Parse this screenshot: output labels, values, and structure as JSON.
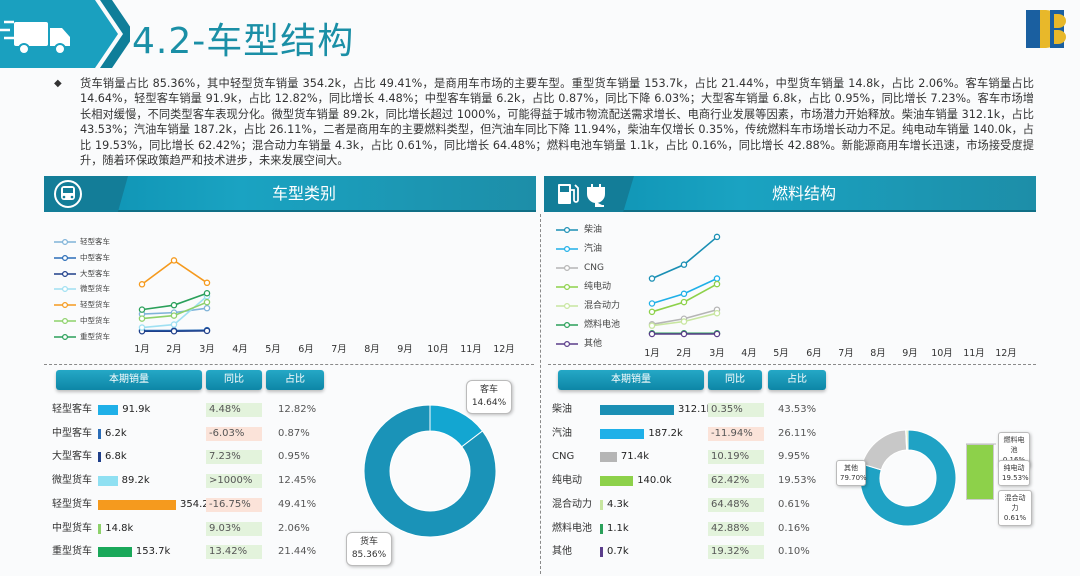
{
  "title": "4.2-车型结构",
  "summary": "货车销量占比 85.36%，其中轻型货车销量 354.2k，占比 49.41%，是商用车市场的主要车型。重型货车销量 153.7k，占比 21.44%，中型货车销量 14.8k，占比 2.06%。客车销量占比 14.64%，轻型客车销量 91.9k，占比 12.82%，同比增长 4.48%；中型客车销量 6.2k，占比 0.87%，同比下降 6.03%；大型客车销量 6.8k，占比 0.95%，同比增长 7.23%。客车市场增长相对缓慢，不同类型客车表现分化。微型货车销量 89.2k，同比增长超过 1000%，可能得益于城市物流配送需求增长、电商行业发展等因素，市场潜力开始释放。柴油车销量 312.1k，占比 43.53%；汽油车销量 187.2k，占比 26.11%，二者是商用车的主要燃料类型，但汽油车同比下降 11.94%，柴油车仅增长 0.35%，传统燃料车市场增长动力不足。纯电动车销量 140.0k，占比 19.53%，同比增长 62.42%；混合动力车销量 4.3k，占比 0.61%，同比增长 64.48%；燃料电池车销量 1.1k，占比 0.16%，同比增长 42.88%。新能源商用车增长迅速，市场接受度提升，随着环保政策趋严和技术进步，未来发展空间大。",
  "left_panel": {
    "title": "车型类别",
    "icon": "bus-icon",
    "headers": [
      "本期销量",
      "同比",
      "占比"
    ],
    "rows": [
      {
        "label": "轻型客车",
        "value": "91.9k",
        "num": 91.9,
        "color": "#1fb0e8",
        "yoy": "4.48%",
        "yoy_up": true,
        "share": "12.82%"
      },
      {
        "label": "中型客车",
        "value": "6.2k",
        "num": 6.2,
        "color": "#2a6db8",
        "yoy": "-6.03%",
        "yoy_up": false,
        "share": "0.87%"
      },
      {
        "label": "大型客车",
        "value": "6.8k",
        "num": 6.8,
        "color": "#1f3f8a",
        "yoy": "7.23%",
        "yoy_up": true,
        "share": "0.95%"
      },
      {
        "label": "微型货车",
        "value": "89.2k",
        "num": 89.2,
        "color": "#8fe0f2",
        "yoy": ">1000%",
        "yoy_up": true,
        "share": "12.45%"
      },
      {
        "label": "轻型货车",
        "value": "354.2k",
        "num": 354.2,
        "color": "#f59a1e",
        "yoy": "-16.75%",
        "yoy_up": false,
        "share": "49.41%"
      },
      {
        "label": "中型货车",
        "value": "14.8k",
        "num": 14.8,
        "color": "#8dd16a",
        "yoy": "9.03%",
        "yoy_up": true,
        "share": "2.06%"
      },
      {
        "label": "重型货车",
        "value": "153.7k",
        "num": 153.7,
        "color": "#1aa85a",
        "yoy": "13.42%",
        "yoy_up": true,
        "share": "21.44%"
      }
    ],
    "donut": [
      {
        "name": "客车",
        "value": 14.64,
        "label": "14.64%",
        "color": "#13a6d1"
      },
      {
        "name": "货车",
        "value": 85.36,
        "label": "85.36%",
        "color": "#1a93b8"
      }
    ]
  },
  "right_panel": {
    "title": "燃料结构",
    "icon": "fuel-charge-icon",
    "headers": [
      "本期销量",
      "同比",
      "占比"
    ],
    "rows": [
      {
        "label": "柴油",
        "value": "312.1k",
        "num": 312.1,
        "color": "#1a8fb4",
        "yoy": "0.35%",
        "yoy_up": true,
        "share": "43.53%"
      },
      {
        "label": "汽油",
        "value": "187.2k",
        "num": 187.2,
        "color": "#1fb0e8",
        "yoy": "-11.94%",
        "yoy_up": false,
        "share": "26.11%"
      },
      {
        "label": "CNG",
        "value": "71.4k",
        "num": 71.4,
        "color": "#b5b5b5",
        "yoy": "10.19%",
        "yoy_up": true,
        "share": "9.95%"
      },
      {
        "label": "纯电动",
        "value": "140.0k",
        "num": 140.0,
        "color": "#8dd14a",
        "yoy": "62.42%",
        "yoy_up": true,
        "share": "19.53%"
      },
      {
        "label": "混合动力",
        "value": "4.3k",
        "num": 4.3,
        "color": "#c8e6a0",
        "yoy": "64.48%",
        "yoy_up": true,
        "share": "0.61%"
      },
      {
        "label": "燃料电池",
        "value": "1.1k",
        "num": 1.1,
        "color": "#2aa05a",
        "yoy": "42.88%",
        "yoy_up": true,
        "share": "0.16%"
      },
      {
        "label": "其他",
        "value": "0.7k",
        "num": 0.7,
        "color": "#5a3d8a",
        "yoy": "19.32%",
        "yoy_up": true,
        "share": "0.10%"
      }
    ],
    "donut": [
      {
        "name": "其他",
        "value": 79.7,
        "label": "79.70%",
        "color": "#1fa2c4"
      },
      {
        "name": "纯电动",
        "value": 19.53,
        "label": "19.53%",
        "color": "#c8c8c8"
      },
      {
        "name": "燃料电池",
        "value": 0.16,
        "label": "0.16%",
        "color": "#2aa05a"
      },
      {
        "name": "混合动力",
        "value": 0.61,
        "label": "0.61%",
        "color": "#c8e6a0"
      }
    ],
    "donut_callouts": [
      {
        "name": "燃料电池",
        "label": "0.16%"
      },
      {
        "name": "纯电动",
        "label": "19.53%"
      },
      {
        "name": "混合动力",
        "label": "0.61%"
      }
    ],
    "donut_main": {
      "name": "其他",
      "label": "79.70%"
    },
    "stack_bar_color": "#8dd14a"
  },
  "chart_data": [
    {
      "type": "line",
      "x": [
        "1月",
        "2月",
        "3月",
        "4月",
        "5月",
        "6月",
        "7月",
        "8月",
        "9月",
        "10月",
        "11月",
        "12月"
      ],
      "series": [
        {
          "name": "轻型客车",
          "color": "#7fb3d8",
          "values": [
            24,
            26,
            32
          ]
        },
        {
          "name": "中型客车",
          "color": "#2a6db8",
          "values": [
            2,
            2,
            2.5
          ]
        },
        {
          "name": "大型客车",
          "color": "#1f3f8a",
          "values": [
            1,
            1,
            1.5
          ]
        },
        {
          "name": "微型货车",
          "color": "#9fe0f2",
          "values": [
            6,
            10,
            48
          ]
        },
        {
          "name": "轻型货车",
          "color": "#f59a1e",
          "values": [
            64,
            96,
            66
          ]
        },
        {
          "name": "中型货车",
          "color": "#8dd16a",
          "values": [
            18,
            22,
            40
          ]
        },
        {
          "name": "重型货车",
          "color": "#2aa05a",
          "values": [
            30,
            36,
            52
          ]
        }
      ],
      "ylim": [
        0,
        110
      ]
    },
    {
      "type": "line",
      "x": [
        "1月",
        "2月",
        "3月",
        "4月",
        "5月",
        "6月",
        "7月",
        "8月",
        "9月",
        "10月",
        "11月",
        "12月"
      ],
      "series": [
        {
          "name": "柴油",
          "color": "#1a8fb4",
          "values": [
            80,
            100,
            140
          ]
        },
        {
          "name": "汽油",
          "color": "#1fb0e8",
          "values": [
            44,
            58,
            80
          ]
        },
        {
          "name": "CNG",
          "color": "#b5b5b5",
          "values": [
            14,
            22,
            35
          ]
        },
        {
          "name": "纯电动",
          "color": "#8dd14a",
          "values": [
            32,
            46,
            72
          ]
        },
        {
          "name": "混合动力",
          "color": "#c8e6a0",
          "values": [
            12,
            18,
            30
          ]
        },
        {
          "name": "燃料电池",
          "color": "#2aa05a",
          "values": [
            1,
            1,
            1
          ]
        },
        {
          "name": "其他",
          "color": "#5a3d8a",
          "values": [
            0,
            0,
            0
          ]
        }
      ],
      "ylim": [
        0,
        150
      ]
    }
  ]
}
